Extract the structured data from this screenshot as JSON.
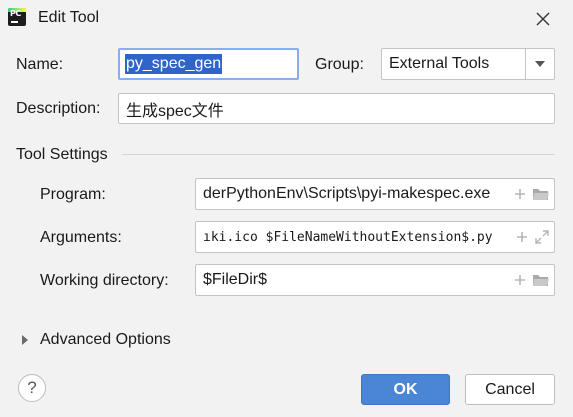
{
  "window": {
    "title": "Edit Tool"
  },
  "form": {
    "name_label": "Name:",
    "name_value": "py_spec_gen",
    "group_label": "Group:",
    "group_value": "External Tools",
    "description_label": "Description:",
    "description_value": "生成spec文件"
  },
  "tool_settings": {
    "heading": "Tool Settings",
    "program_label": "Program:",
    "program_value": "derPythonEnv\\Scripts\\pyi-makespec.exe",
    "arguments_label": "Arguments:",
    "arguments_value": "ıki.ico $FileNameWithoutExtension$.py",
    "working_dir_label": "Working directory:",
    "working_dir_value": "$FileDir$"
  },
  "advanced": {
    "label": "Advanced Options"
  },
  "buttons": {
    "ok": "OK",
    "cancel": "Cancel",
    "help": "?"
  },
  "icons": {
    "app": "pycharm-logo",
    "close": "close-icon",
    "add": "plus-icon",
    "browse": "folder-icon",
    "expand": "expand-icon",
    "dropdown": "chevron-down-icon",
    "expander": "triangle-right-icon"
  },
  "colors": {
    "accent": "#4a86d3",
    "selection": "#2f65ca",
    "focus_border": "#86aef0"
  }
}
